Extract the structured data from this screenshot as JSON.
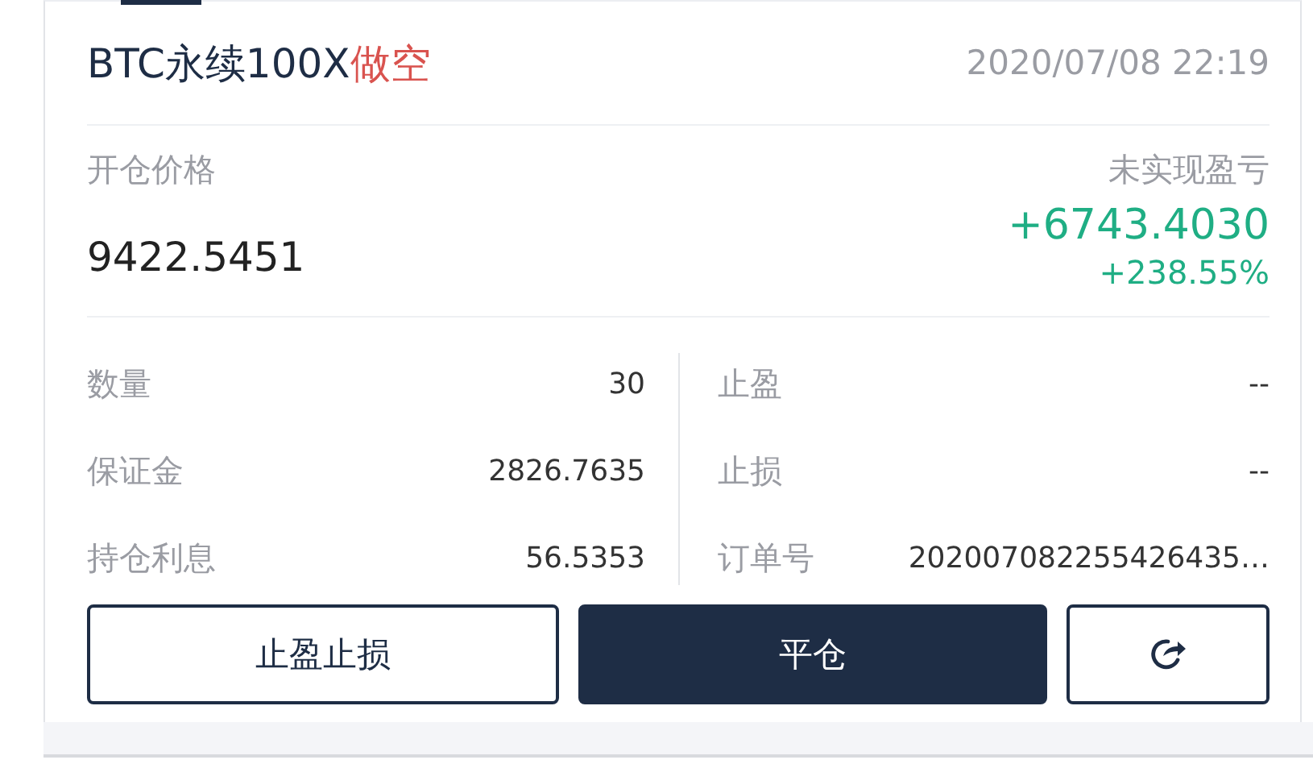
{
  "title": {
    "symbol": "BTC永续100X",
    "side": {
      "text": "做空",
      "kind": "short"
    },
    "time": "2020/07/08 22:19"
  },
  "entry": {
    "label": "开仓价格",
    "value": "9422.5451"
  },
  "pnl": {
    "label": "未实现盈亏",
    "value": "+6743.4030",
    "percent": "+238.55%",
    "kind": "profit"
  },
  "left_fields": [
    {
      "label": "数量",
      "value": "30"
    },
    {
      "label": "保证金",
      "value": "2826.7635"
    },
    {
      "label": "持仓利息",
      "value": "56.5353"
    }
  ],
  "right_fields": [
    {
      "label": "止盈",
      "value": "--"
    },
    {
      "label": "止损",
      "value": "--"
    },
    {
      "label": "订单号",
      "value": "202007082255426435…"
    }
  ],
  "buttons": [
    {
      "label": "止盈止损",
      "kind": "outline"
    },
    {
      "label": "平仓",
      "kind": "primary"
    },
    {
      "kind": "share"
    }
  ]
}
